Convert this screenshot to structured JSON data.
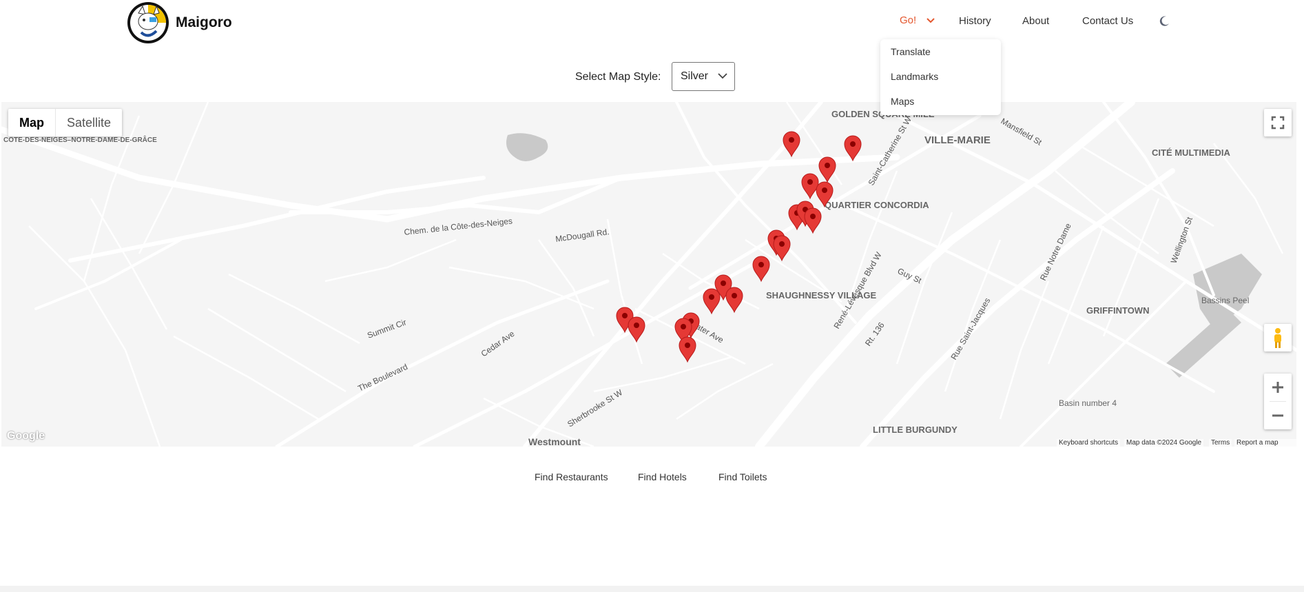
{
  "brand": {
    "name": "Maigoro"
  },
  "nav": {
    "go_label": "Go!",
    "history_label": "History",
    "about_label": "About",
    "contact_label": "Contact Us",
    "theme_icon": "moon-icon",
    "dropdown": [
      "Translate",
      "Landmarks",
      "Maps"
    ]
  },
  "map_style": {
    "label": "Select Map Style:",
    "selected": "Silver"
  },
  "map": {
    "type_buttons": [
      "Map",
      "Satellite"
    ],
    "active_type": "Map",
    "logo_text": "Google",
    "footer": {
      "shortcuts": "Keyboard shortcuts",
      "data": "Map data ©2024 Google",
      "terms": "Terms",
      "report": "Report a map error"
    },
    "labels": [
      "GOLDEN SQUARE MILE",
      "VILLE-MARIE",
      "CITÉ MULTIMEDIA",
      "QUARTIER CONCORDIA",
      "SHAUGHNESSY VILLAGE",
      "GRIFFINTOWN",
      "LITTLE BURGUNDY",
      "Westmount",
      "CÔTE-DES-NEIGES–NOTRE-DAME-DE-GRÂCE",
      "Bassins Peel",
      "Basin number 4",
      "Chem. de la Côte-des-Neiges",
      "McDougall Rd.",
      "Cedar Ave",
      "The Boulevard",
      "Sherbrooke St W",
      "Atwater Ave",
      "René-Lévesque Blvd W",
      "Guy St",
      "Rue Saint-Jacques",
      "Rt. 136",
      "Wellington St",
      "Rue Notre Dame",
      "Summit Cir",
      "Mansfield St",
      "Saint-Catherine St W"
    ],
    "pin_color": "#e53935"
  },
  "find_links": [
    "Find Restaurants",
    "Find Hotels",
    "Find Toilets"
  ],
  "colors": {
    "accent": "#e4572e",
    "map_bg": "#f5f5f5",
    "road": "#ffffff"
  }
}
